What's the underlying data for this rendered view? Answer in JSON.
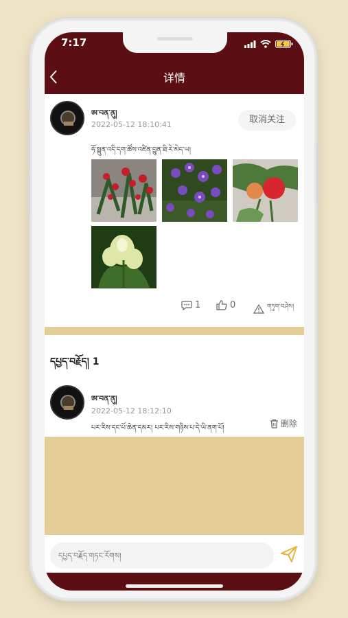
{
  "status": {
    "time": "7:17"
  },
  "header": {
    "title": "详情",
    "back_label": "<"
  },
  "post": {
    "username": "ཨ་བན་ནུ།",
    "date": "2022-05-12 18:10:41",
    "follow_label": "取消关注",
    "text": "ཧོ་སྦྲུན་འདི་དག་ཚོས་འཛིན་བྱུན་ཐི་རེ་མེད་ཡ།",
    "comment_count": "1",
    "like_count": "0",
    "report_label": "གཏུག་བཤེས།"
  },
  "comments": {
    "header": "དཔྱད་བརྗོད། 1",
    "items": [
      {
        "username": "ཨ་བན་ནུ།",
        "date": "2022-05-12 18:12:10",
        "text": "པར་རིས་དང་པོ་ཆེན་དམར། པར་རིས་གཉིས་པ་དེ་ཡི་ནག་པོ།",
        "delete_label": "删除"
      }
    ]
  },
  "input": {
    "placeholder": "དཔྱད་བརྗོད་གཏང་རོགས།"
  },
  "colors": {
    "brand": "#5c0f12",
    "band": "#e5cd97",
    "background": "#efe3c6",
    "send": "#e7b43a"
  },
  "icons": [
    "back-icon",
    "signal-icon",
    "wifi-icon",
    "battery-icon",
    "comment-icon",
    "like-icon",
    "warning-icon",
    "trash-icon",
    "send-icon"
  ]
}
